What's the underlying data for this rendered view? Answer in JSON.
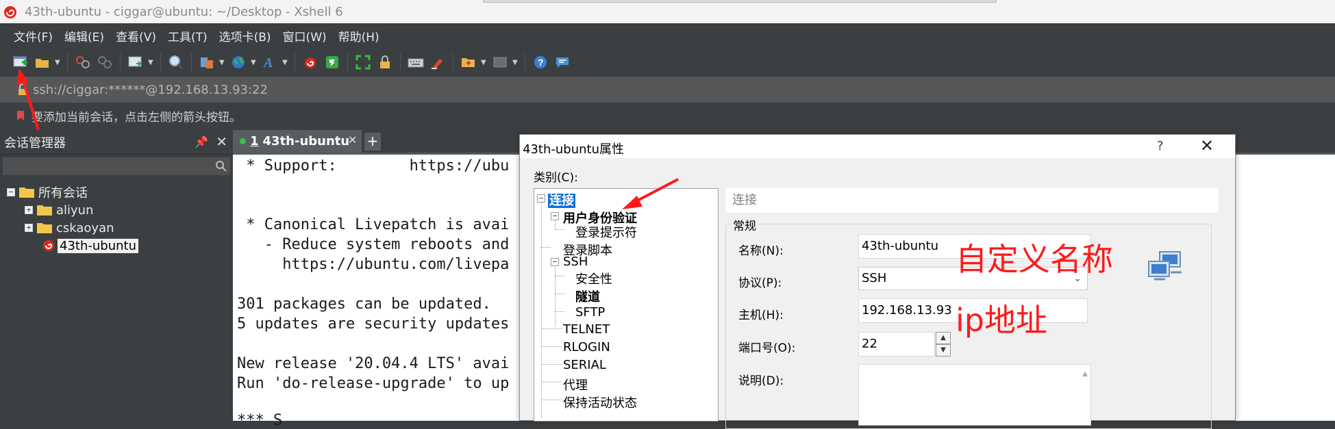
{
  "window": {
    "title": "43th-ubuntu - ciggar@ubuntu: ~/Desktop - Xshell 6"
  },
  "menu": [
    "文件(F)",
    "编辑(E)",
    "查看(V)",
    "工具(T)",
    "选项卡(B)",
    "窗口(W)",
    "帮助(H)"
  ],
  "address": {
    "text": "ssh://ciggar:******@192.168.13.93:22"
  },
  "hint": {
    "text": "要添加当前会话，点击左侧的箭头按钮。"
  },
  "session_manager": {
    "title": "会话管理器",
    "tree": {
      "root": "所有会话",
      "items": [
        "aliyun",
        "cskaoyan",
        "43th-ubuntu"
      ]
    }
  },
  "tab": {
    "number": "1",
    "label": "43th-ubuntu"
  },
  "terminal": {
    "lines": [
      " * Support:        https://ubu",
      "",
      "",
      " * Canonical Livepatch is avai",
      "   - Reduce system reboots and",
      "     https://ubuntu.com/livepa",
      "",
      "301 packages can be updated.",
      "5 updates are security updates",
      "",
      "New release '20.04.4 LTS' avai",
      "Run 'do-release-upgrade' to up",
      "",
      "*** S"
    ]
  },
  "dialog": {
    "title": "43th-ubuntu属性",
    "help": "?",
    "category_label": "类别(C):",
    "categories": {
      "connection": "连接",
      "auth": "用户身份验证",
      "login_prompt": "登录提示符",
      "login_script": "登录脚本",
      "ssh": "SSH",
      "security": "安全性",
      "tunnel": "隧道",
      "sftp": "SFTP",
      "telnet": "TELNET",
      "rlogin": "RLOGIN",
      "serial": "SERIAL",
      "proxy": "代理",
      "keepalive": "保持活动状态"
    },
    "section_title": "连接",
    "group_title": "常规",
    "fields": {
      "name_label": "名称(N):",
      "name_value": "43th-ubuntu",
      "protocol_label": "协议(P):",
      "protocol_value": "SSH",
      "host_label": "主机(H):",
      "host_value": "192.168.13.93",
      "port_label": "端口号(O):",
      "port_value": "22",
      "desc_label": "说明(D):"
    }
  },
  "annotations": {
    "name_note": "自定义名称",
    "ip_note": "ip地址"
  },
  "colors": {
    "annotation": "#ff1a1a",
    "selection": "#0f73d6",
    "session_dot": "#38c24b"
  }
}
